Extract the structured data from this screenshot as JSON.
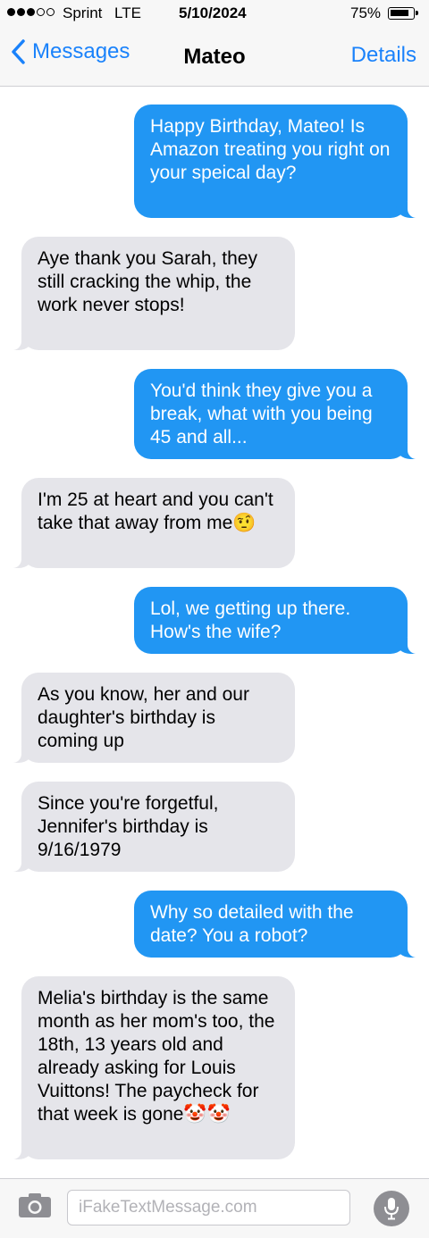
{
  "status_bar": {
    "signal_dots_filled": 3,
    "signal_dots_total": 5,
    "carrier": "Sprint",
    "network": "LTE",
    "date": "5/10/2024",
    "battery_percent": "75%",
    "battery_level": 0.75
  },
  "nav": {
    "back_label": "Messages",
    "contact_name": "Mateo",
    "details_label": "Details"
  },
  "messages": [
    {
      "sender": "me",
      "text": "Happy Birthday, Mateo! Is Amazon treating you right on your speical day?"
    },
    {
      "sender": "contact",
      "text": "Aye thank you Sarah, they still cracking the whip, the work never stops!"
    },
    {
      "sender": "me",
      "text": "You'd think they give you a break, what with you being 45 and all..."
    },
    {
      "sender": "contact",
      "text": "I'm 25 at heart and you can't take that away from me🤨"
    },
    {
      "sender": "me",
      "text": "Lol, we getting up there. How's the wife?"
    },
    {
      "sender": "contact",
      "text": "As you know, her and our daughter's birthday is coming up"
    },
    {
      "sender": "contact",
      "text": "Since you're forgetful, Jennifer's birthday is 9/16/1979"
    },
    {
      "sender": "me",
      "text": "Why so detailed with the date? You a robot?"
    },
    {
      "sender": "contact",
      "text": "Melia's birthday is the same month as her mom's too, the 18th, 13 years old and already asking for Louis Vuittons! The paycheck for that week is gone🤡🤡"
    }
  ],
  "input_bar": {
    "placeholder": "iFakeTextMessage.com"
  },
  "icons": {
    "back": "chevron-left-icon",
    "camera": "camera-icon",
    "mic": "microphone-icon"
  },
  "colors": {
    "accent": "#1a82fb",
    "sent_bubble": "#2196f3",
    "received_bubble": "#e5e5ea"
  }
}
